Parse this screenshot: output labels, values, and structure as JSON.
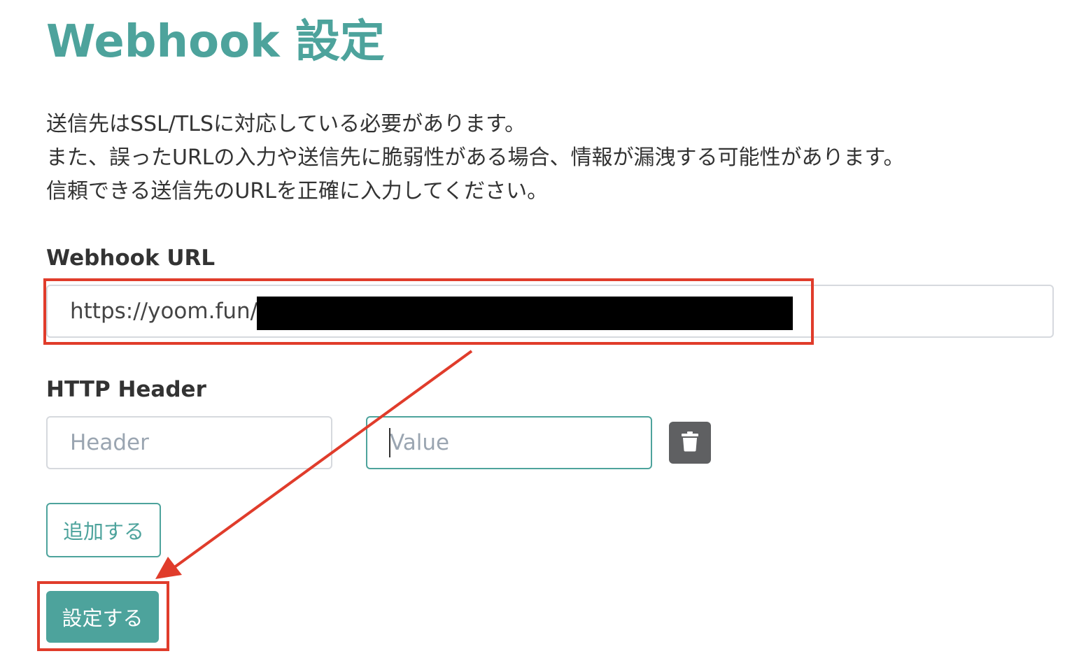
{
  "page": {
    "title": "Webhook 設定",
    "description": [
      "送信先はSSL/TLSに対応している必要があります。",
      "また、誤ったURLの入力や送信先に脆弱性がある場合、情報が漏洩する可能性があります。",
      "信頼できる送信先のURLを正確に入力してください。"
    ]
  },
  "webhook_url": {
    "label": "Webhook URL",
    "value": "https://yoom.fun/"
  },
  "http_header": {
    "label": "HTTP Header",
    "header_placeholder": "Header",
    "value_placeholder": "Value",
    "delete_icon": "trash-icon"
  },
  "buttons": {
    "add_label": "追加する",
    "save_label": "設定する"
  },
  "colors": {
    "accent": "#4da39c",
    "annotation": "#e03c2b",
    "delete_button": "#5f6062"
  }
}
